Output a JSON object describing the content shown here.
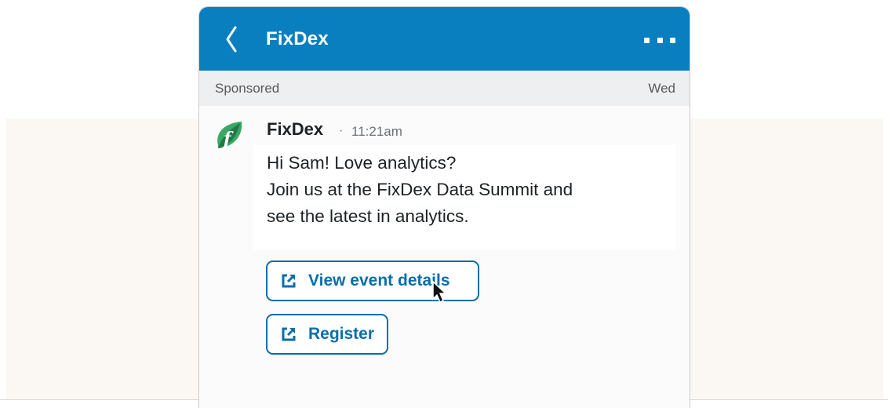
{
  "colors": {
    "header_bg": "#0a7fc0",
    "accent": "#0a6ea8",
    "band_bg": "#fbf8f3",
    "sponsor_bar_bg": "#eeeff0",
    "logo_green": "#2e9e5b"
  },
  "header": {
    "back_icon": "chevron-left-icon",
    "title": "FixDex",
    "menu_icon": "more-options-icon"
  },
  "sponsor_bar": {
    "label": "Sponsored",
    "day": "Wed"
  },
  "message": {
    "logo_icon": "fixdex-logo-icon",
    "sender": "FixDex",
    "separator": "·",
    "time": "11:21am",
    "lines": [
      "Hi Sam! Love analytics?",
      "Join us at the FixDex Data Summit and",
      "see the latest in analytics."
    ]
  },
  "actions": [
    {
      "label": "View event details",
      "icon": "external-link-icon"
    },
    {
      "label": "Register",
      "icon": "external-link-icon"
    }
  ],
  "cursor_icon": "mouse-pointer-icon"
}
